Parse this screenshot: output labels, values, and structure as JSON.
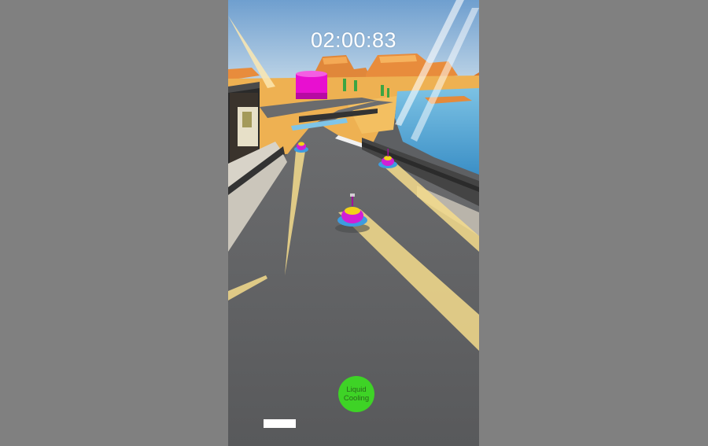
{
  "hud": {
    "timer": "02:00:83",
    "ability_button": {
      "label": "Liquid\nCooling",
      "color": "#3ed326"
    },
    "boost_meter": {
      "level": 1.0,
      "color": "#ffffff"
    }
  },
  "scene": {
    "icons": [
      "player-bumper-car",
      "rival-bumper-car",
      "water-tower",
      "cactus",
      "mesa-rock"
    ],
    "colors": {
      "track": "#5e6063",
      "sky": "#9fc2e0",
      "sand": "#f2b04e",
      "water": "#4fa6d3",
      "car_body": "#d21fd6",
      "car_bumper": "#3e9ce0",
      "car_top": "#f2d21b",
      "light_beam": "#f5dc8c",
      "tower": "#e80fd0"
    }
  }
}
